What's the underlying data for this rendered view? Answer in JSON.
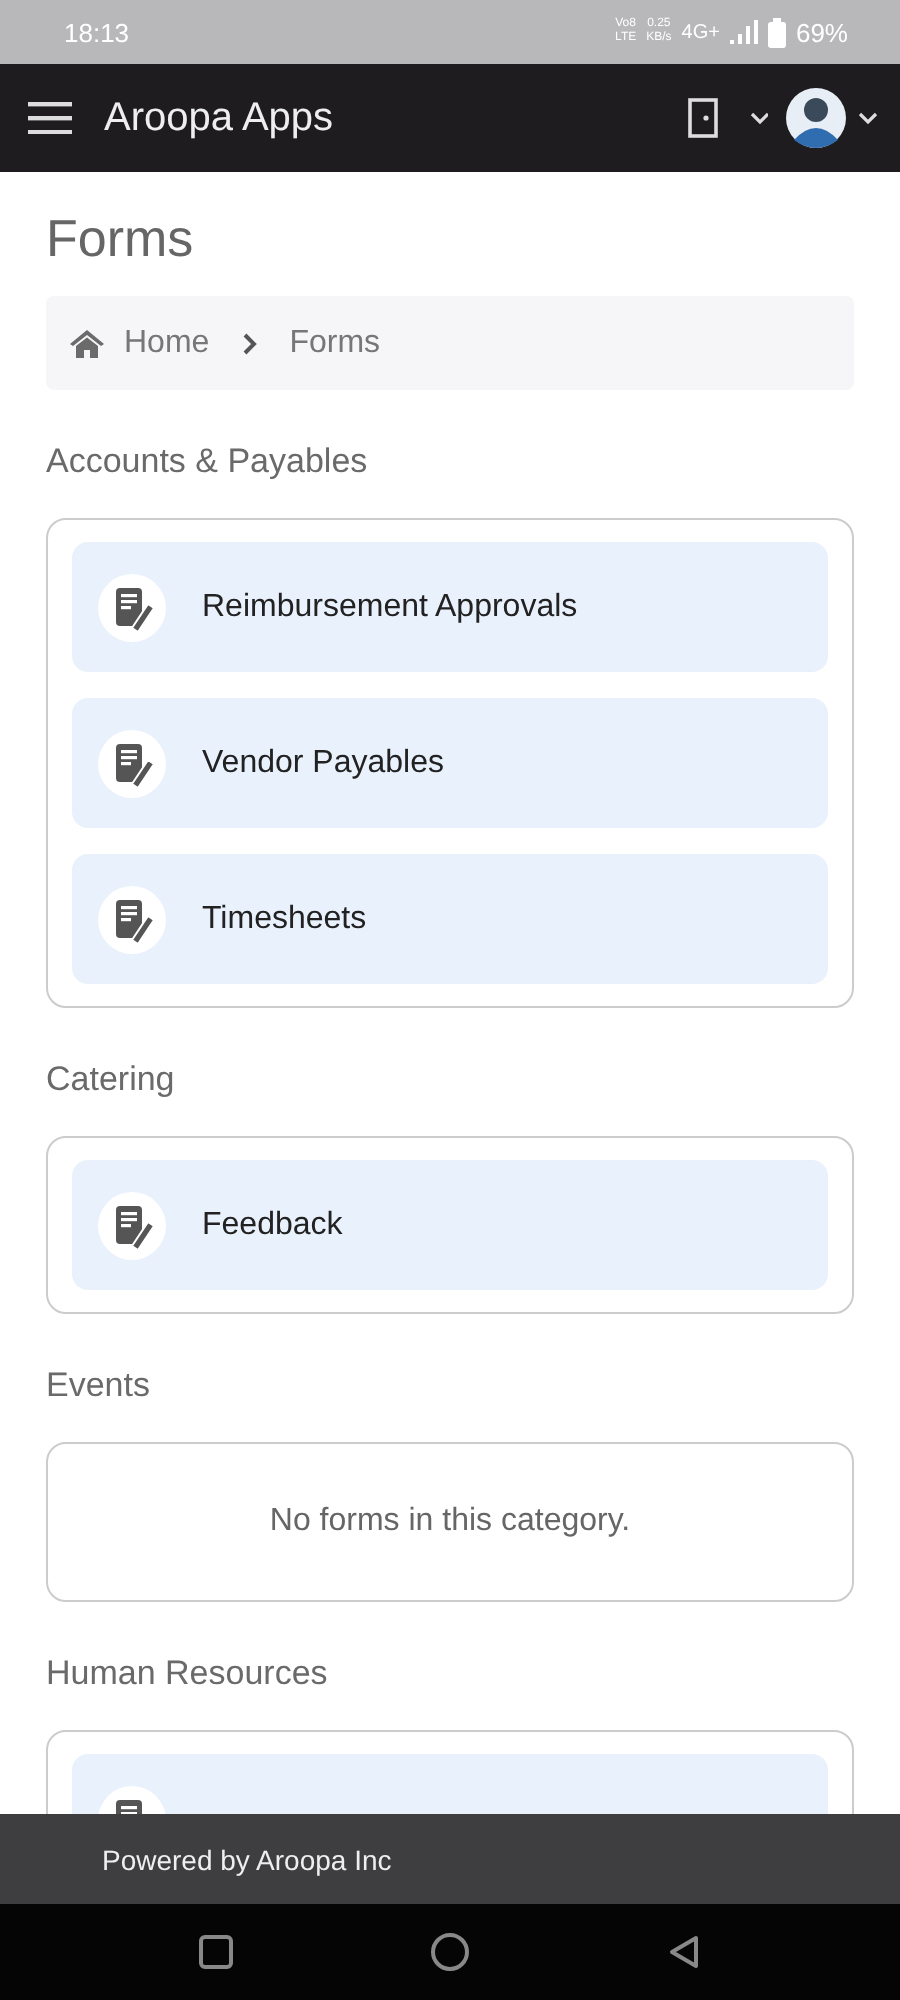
{
  "status_bar": {
    "time": "18:13",
    "volte": [
      "Vo8",
      "LTE"
    ],
    "speed": [
      "0.25",
      "KB/s"
    ],
    "network": "4G+",
    "battery": "69%"
  },
  "app_bar": {
    "title": "Aroopa Apps"
  },
  "page": {
    "title": "Forms"
  },
  "breadcrumb": [
    {
      "label": "Home",
      "kind": "home"
    },
    {
      "label": "Forms",
      "kind": "current"
    }
  ],
  "categories": [
    {
      "name": "Accounts & Payables",
      "forms": [
        {
          "label": "Reimbursement Approvals"
        },
        {
          "label": "Vendor Payables"
        },
        {
          "label": "Timesheets"
        }
      ]
    },
    {
      "name": "Catering",
      "forms": [
        {
          "label": "Feedback"
        }
      ]
    },
    {
      "name": "Events",
      "empty_message": "No forms in this category."
    },
    {
      "name": "Human Resources",
      "forms": [
        {
          "kind": "form"
        }
      ]
    }
  ],
  "footer": {
    "text": "Powered by Aroopa Inc"
  }
}
